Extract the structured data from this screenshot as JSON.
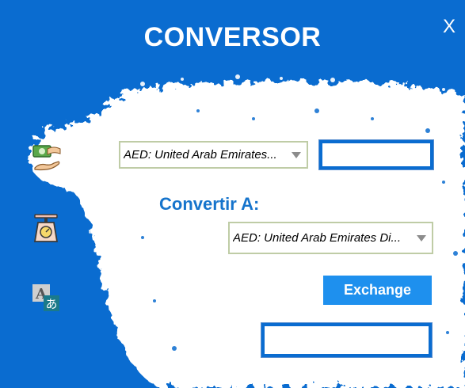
{
  "window": {
    "title": "CONVERSOR",
    "close_label": "X"
  },
  "sidebar": {
    "items": [
      {
        "name": "currency",
        "icon": "money-exchange-icon"
      },
      {
        "name": "weight",
        "icon": "weighing-scale-icon"
      },
      {
        "name": "language",
        "icon": "translate-icon"
      }
    ]
  },
  "form": {
    "from_select_value": "AED: United Arab Emirates...",
    "amount_value": "",
    "convert_to_label": "Convertir A:",
    "to_select_value": "AED: United Arab Emirates Di...",
    "exchange_label": "Exchange",
    "result_value": ""
  },
  "colors": {
    "accent": "#0a6cd0",
    "button": "#1e90ee",
    "label": "#1674cc",
    "dropdown_border": "#bfcca6"
  }
}
